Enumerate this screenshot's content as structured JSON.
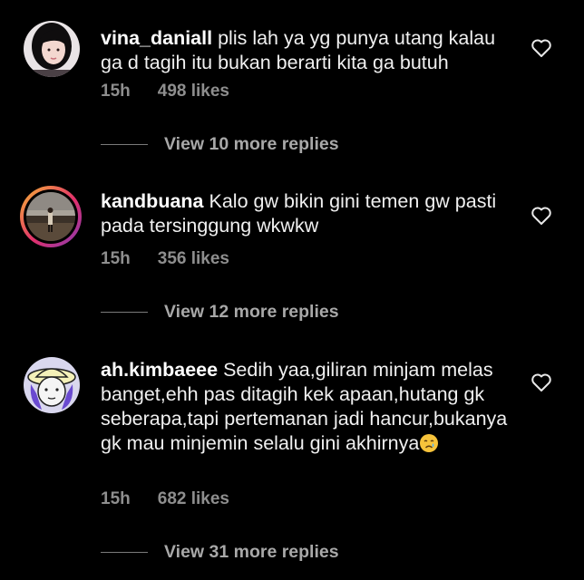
{
  "comments": [
    {
      "username": "vina_daniall",
      "text": "plis lah ya yg punya utang kalau ga d tagih itu bukan berarti kita ga butuh",
      "time": "15h",
      "likes": "498 likes",
      "replies": "View 10 more replies",
      "liked": false
    },
    {
      "username": "kandbuana",
      "text": "Kalo gw bikin gini temen gw pasti pada tersinggung wkwkw",
      "time": "15h",
      "likes": "356 likes",
      "replies": "View 12 more replies",
      "liked": false
    },
    {
      "username": "ah.kimbaeee",
      "text": "Sedih yaa,giliran minjam melas banget,ehh pas ditagih kek apaan,hutang gk seberapa,tapi pertemanan jadi hancur,bukanya gk mau minjemin selalu gini akhirnya",
      "emoji": "crying-face",
      "time": "15h",
      "likes": "682 likes",
      "replies": "View 31 more replies",
      "liked": false
    }
  ],
  "colors": {
    "background": "#000000",
    "text": "#f0f0f0",
    "muted": "#8e8e8e",
    "story_ring": "#e1306c"
  }
}
